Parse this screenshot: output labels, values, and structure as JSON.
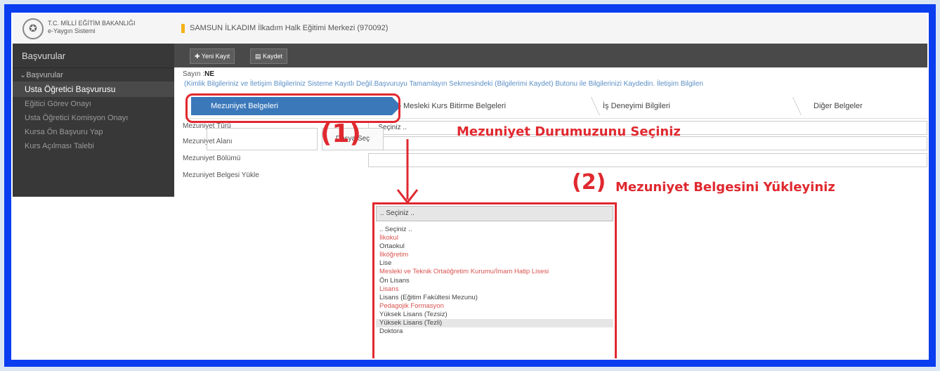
{
  "header": {
    "ministry_line1": "T.C. MİLLİ EĞİTİM BAKANLIĞI",
    "ministry_line2": "e-Yaygın Sistemi",
    "center_name": "SAMSUN İLKADIM İlkadım Halk Eğitimi Merkezi (970092)"
  },
  "sidebar": {
    "title": "Başvurular",
    "section": "Başvurular",
    "items": [
      {
        "label": "Usta Öğretici Başvurusu",
        "active": true
      },
      {
        "label": "Eğitici Görev Onayı"
      },
      {
        "label": "Usta Öğretici Komisyon Onayı"
      },
      {
        "label": "Kursa Ön Başvuru Yap"
      },
      {
        "label": "Kurs Açılması Talebi"
      }
    ]
  },
  "toolbar": {
    "new_label": "Yeni Kayıt",
    "save_label": "Kaydet"
  },
  "content": {
    "sayin_label": "Sayın :",
    "sayin_name": "NE",
    "notice": "(Kimlik Bilgileriniz ve İletişim Bilgileriniz Sisteme Kayıtlı Değil.Başvuruyu Tamamlayın Sekmesindeki (Bilgilerimi Kaydet) Butonu ile Bilgilerinizi Kaydedin. İletişim Bilgilen"
  },
  "tabs": [
    "Mezuniyet Belgeleri",
    "Mesleki Kurs Bitirme Belgeleri",
    "İş Deneyimi Bilgileri",
    "Diğer Belgeler"
  ],
  "form": {
    "type_label": "Mezuniyet Türü",
    "type_value": ".. Seçiniz ..",
    "area_label": "Mezuniyet Alanı",
    "dept_label": "Mezuniyet Bölümü",
    "upload_label": "Mezuniyet Belgesi Yükle",
    "file_button": "Dosya Seç"
  },
  "annotations": {
    "step1": "(1)",
    "step1_text": "Mezuniyet Durumuzunu Seçiniz",
    "step2": "(2)",
    "step2_text": "Mezuniyet Belgesini Yükleyiniz"
  },
  "dropdown": {
    "selected": ".. Seçiniz ..",
    "options": [
      {
        "label": ".. Seçiniz ..",
        "red": false
      },
      {
        "label": "İlkokul",
        "red": true
      },
      {
        "label": "Ortaokul",
        "red": false
      },
      {
        "label": "İlköğretim",
        "red": true
      },
      {
        "label": "Lise",
        "red": false
      },
      {
        "label": "Mesleki ve Teknik Ortaöğretim Kurumu/İmam Hatip Lisesi",
        "red": true
      },
      {
        "label": "Ön Lisans",
        "red": false
      },
      {
        "label": "Lisans",
        "red": true
      },
      {
        "label": "Lisans (Eğitim Fakültesi Mezunu)",
        "red": false
      },
      {
        "label": "Pedagojik Formasyon",
        "red": true
      },
      {
        "label": "Yüksek Lisans (Tezsiz)",
        "red": false
      },
      {
        "label": "Yüksek Lisans (Tezli)",
        "red": false,
        "highlighted": true
      },
      {
        "label": "Doktora",
        "red": false
      }
    ]
  },
  "colors": {
    "frame": "#0a3df0",
    "accent_tab": "#3b78ba",
    "annotation": "#e0282f"
  }
}
